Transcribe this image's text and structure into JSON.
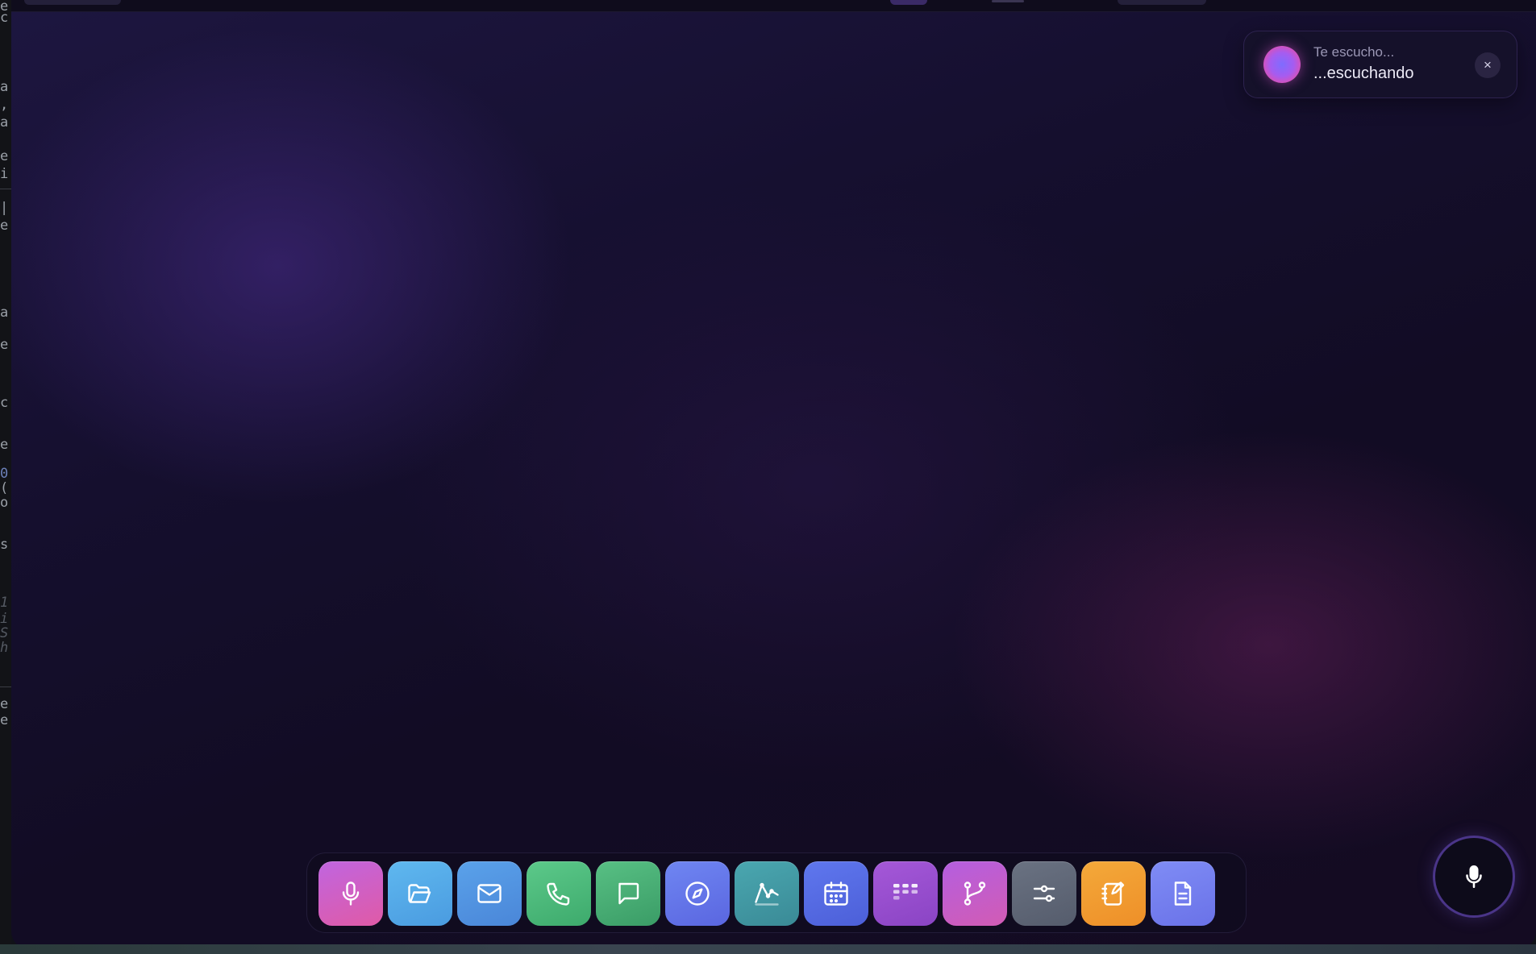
{
  "toast": {
    "title": "Te escucho...",
    "subtitle": "...escuchando",
    "close_label": "×"
  },
  "dock": {
    "items": [
      {
        "name": "voice",
        "icon": "microphone-icon",
        "color_from": "#c065e0",
        "color_to": "#e05aa6"
      },
      {
        "name": "files",
        "icon": "folder-open-icon",
        "color_from": "#5fb8ef",
        "color_to": "#4a9be0"
      },
      {
        "name": "mail",
        "icon": "mail-icon",
        "color_from": "#5aa2ea",
        "color_to": "#4a86d8"
      },
      {
        "name": "phone",
        "icon": "phone-icon",
        "color_from": "#5cc98a",
        "color_to": "#3daa6c"
      },
      {
        "name": "messages",
        "icon": "chat-bubble-icon",
        "color_from": "#58c084",
        "color_to": "#3a9c66"
      },
      {
        "name": "browser",
        "icon": "compass-icon",
        "color_from": "#6f86f2",
        "color_to": "#5a66e0"
      },
      {
        "name": "analytics",
        "icon": "line-chart-icon",
        "color_from": "#4aa7b0",
        "color_to": "#3a8a96"
      },
      {
        "name": "calendar",
        "icon": "calendar-icon",
        "color_from": "#5f77ee",
        "color_to": "#4c5fd8"
      },
      {
        "name": "board",
        "icon": "kanban-icon",
        "color_from": "#a558d8",
        "color_to": "#8a44c4"
      },
      {
        "name": "git",
        "icon": "git-branch-icon",
        "color_from": "#b45ee0",
        "color_to": "#d25cb4"
      },
      {
        "name": "settings",
        "icon": "sliders-icon",
        "color_from": "#6a7282",
        "color_to": "#555c6c"
      },
      {
        "name": "notes",
        "icon": "notebook-edit-icon",
        "color_from": "#f4a93a",
        "color_to": "#ee8f28"
      },
      {
        "name": "document",
        "icon": "document-icon",
        "color_from": "#7f8cf5",
        "color_to": "#6a72e8"
      }
    ]
  },
  "mic_button": {
    "icon": "microphone-icon"
  }
}
